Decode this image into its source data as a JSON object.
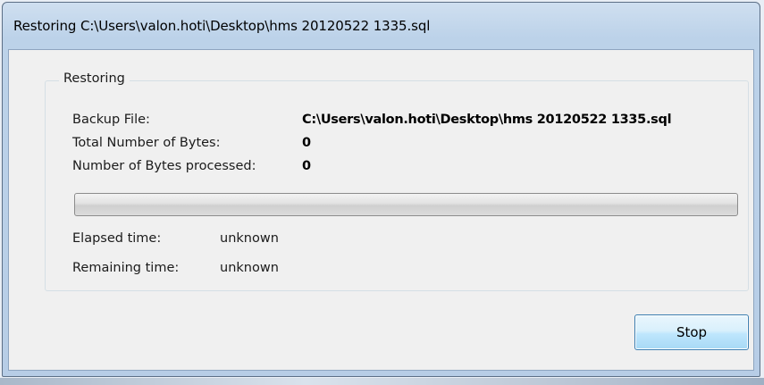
{
  "window": {
    "title": "Restoring C:\\Users\\valon.hoti\\Desktop\\hms 20120522 1335.sql"
  },
  "group": {
    "label": "Restoring"
  },
  "fields": {
    "backup_file_label": "Backup File:",
    "backup_file_value": "C:\\Users\\valon.hoti\\Desktop\\hms 20120522 1335.sql",
    "total_bytes_label": "Total Number of Bytes:",
    "total_bytes_value": "0",
    "bytes_processed_label": "Number of Bytes processed:",
    "bytes_processed_value": "0",
    "elapsed_label": "Elapsed time:",
    "elapsed_value": "unknown",
    "remaining_label": "Remaining time:",
    "remaining_value": "unknown"
  },
  "progress": {
    "fraction": 0.0
  },
  "buttons": {
    "stop_label": "Stop"
  },
  "colors": {
    "titlebar": "#bcd2e9",
    "client_bg": "#f0f0f0",
    "button_border": "#3c7fb1"
  }
}
